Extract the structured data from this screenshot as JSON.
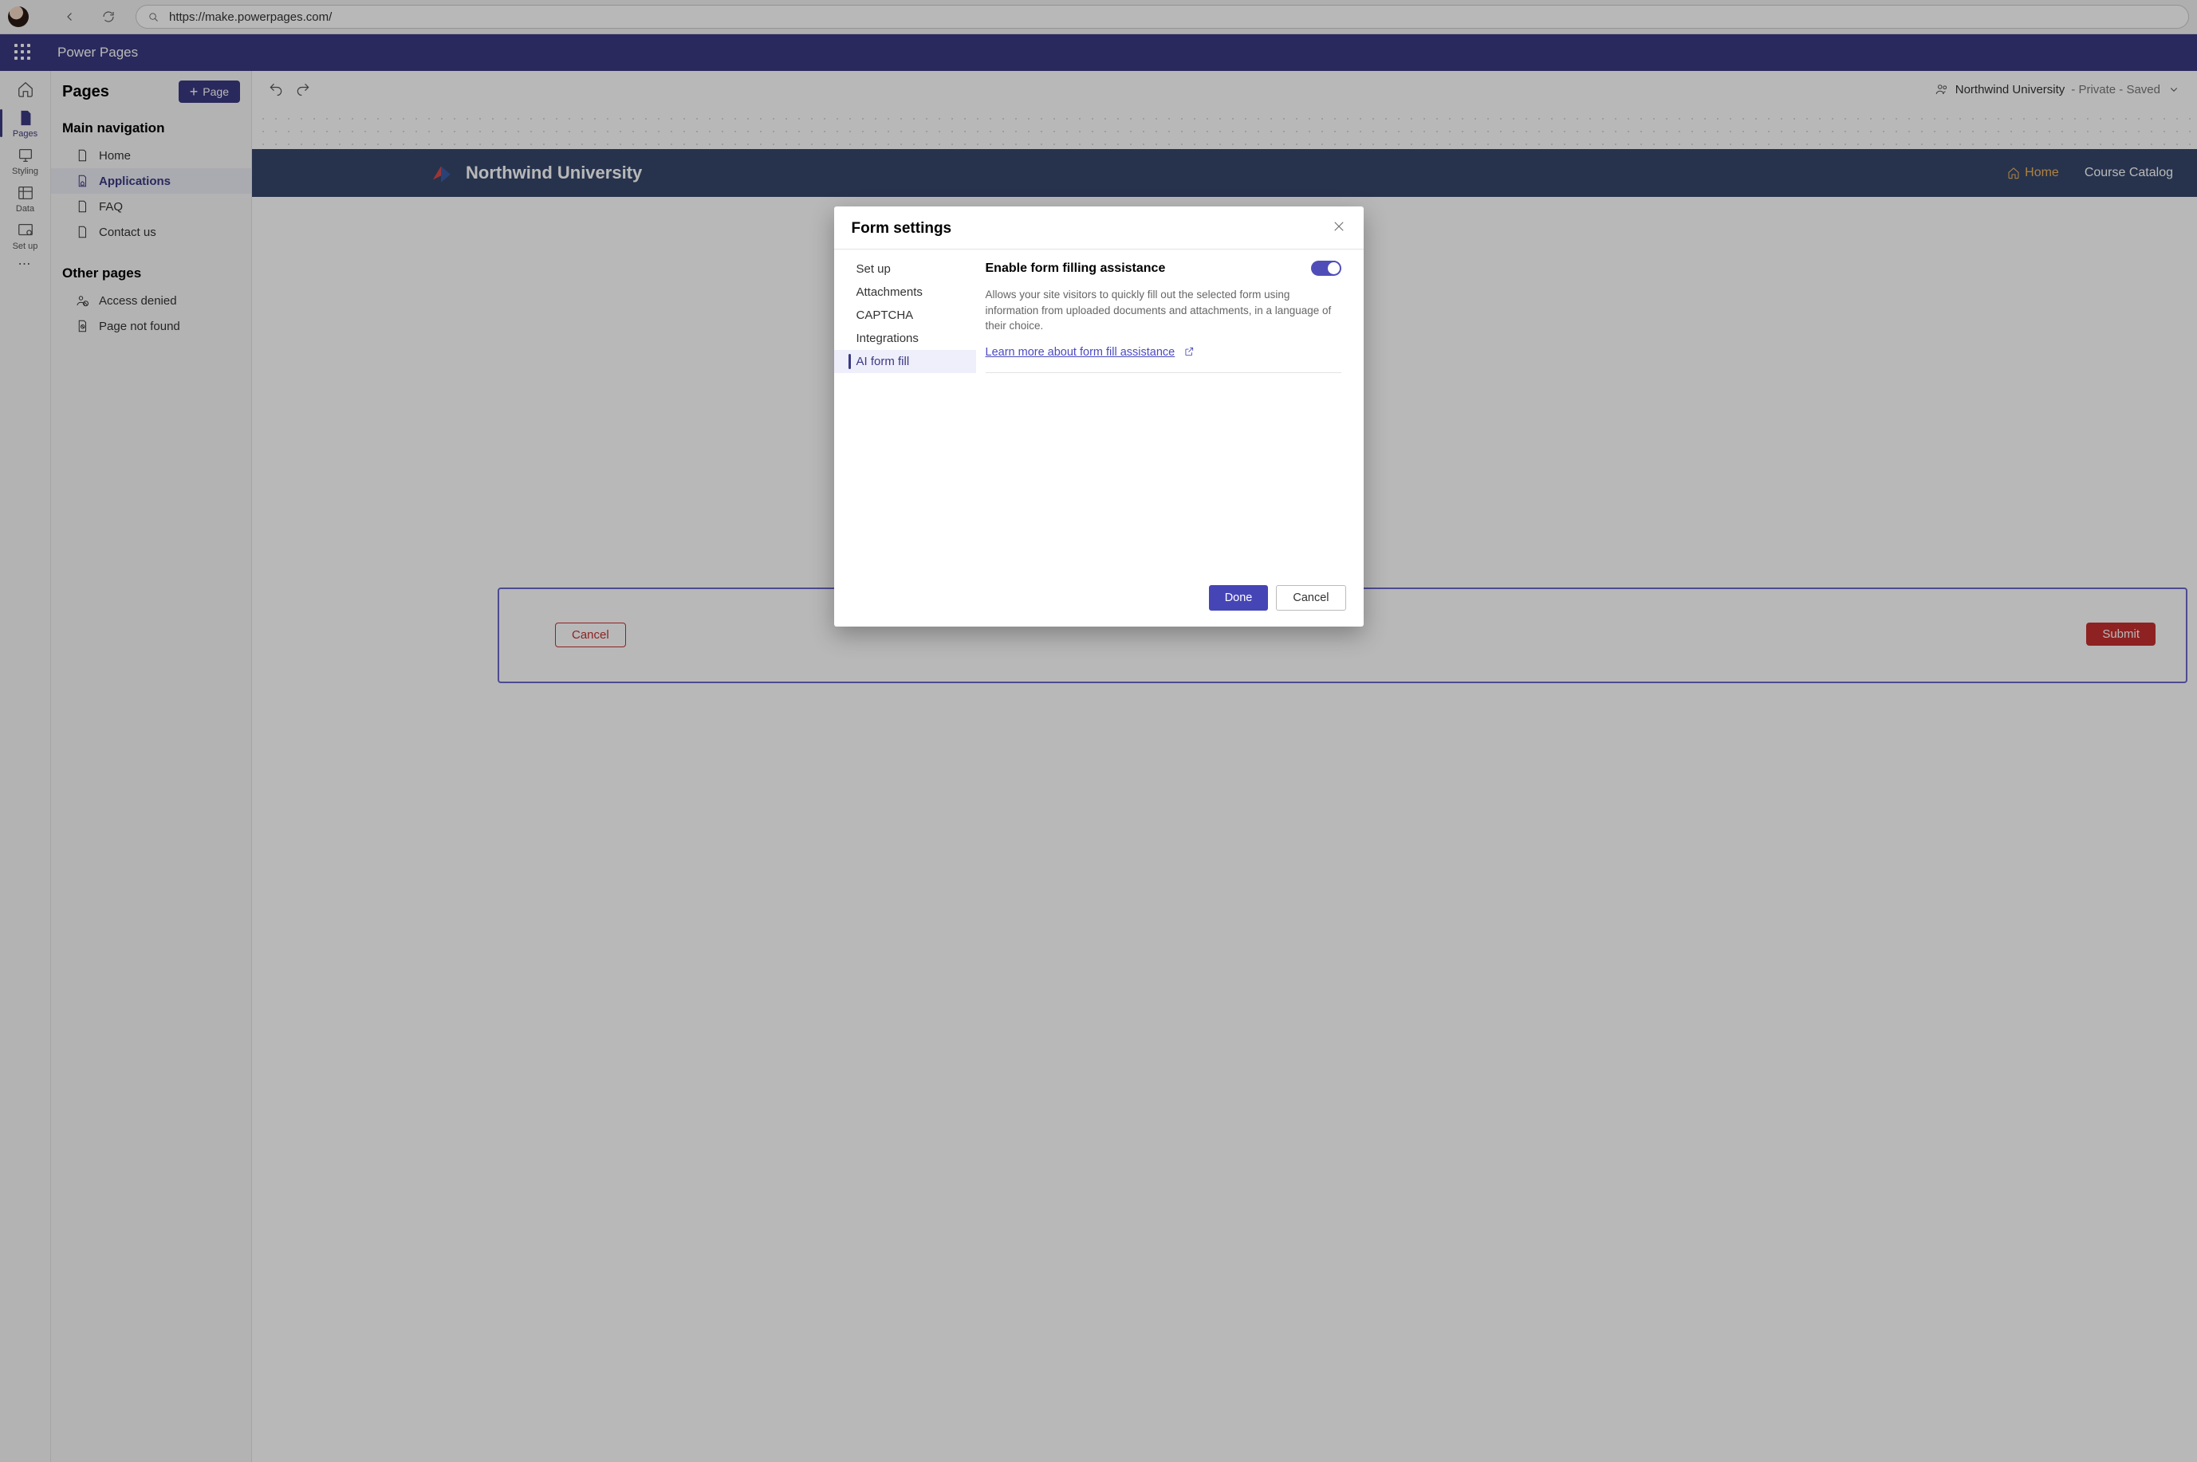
{
  "browser": {
    "url": "https://make.powerpages.com/"
  },
  "suite": {
    "brand": "Power Pages"
  },
  "rail": {
    "pages": "Pages",
    "styling": "Styling",
    "data": "Data",
    "setup": "Set up"
  },
  "nav": {
    "title": "Pages",
    "addBtn": "Page",
    "sectionMain": "Main navigation",
    "sectionOther": "Other pages",
    "main": [
      "Home",
      "Applications",
      "FAQ",
      "Contact us"
    ],
    "other": [
      "Access denied",
      "Page not found"
    ]
  },
  "cmdbar": {
    "site": "Northwind University",
    "status": " - Private - Saved"
  },
  "siteHead": {
    "title": "Northwind University",
    "home": "Home",
    "catalog": "Course Catalog"
  },
  "form": {
    "cancel": "Cancel",
    "submit": "Submit"
  },
  "modal": {
    "title": "Form settings",
    "tabs": [
      "Set up",
      "Attachments",
      "CAPTCHA",
      "Integrations",
      "AI form fill"
    ],
    "heading": "Enable form filling assistance",
    "desc": "Allows your site visitors to quickly fill out the selected form using information from uploaded documents and attachments, in a language of their choice.",
    "link": "Learn more about form fill assistance",
    "done": "Done",
    "cancel": "Cancel"
  }
}
